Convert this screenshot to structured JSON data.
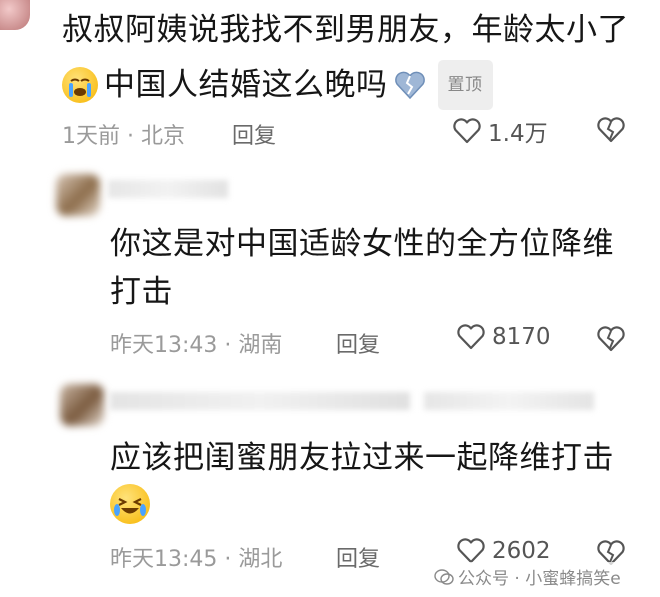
{
  "top_comment": {
    "line1": "叔叔阿姨说我找不到男朋友，年龄太小了",
    "line2_text": "中国人结婚这么晚吗",
    "pin_label": "置顶",
    "time_location": "1天前 · 北京",
    "reply_label": "回复",
    "like_count": "1.4万"
  },
  "replies": [
    {
      "text_line1": "你这是对中国适龄女性的全方位降维",
      "text_line2": "打击",
      "time_location": "昨天13:43 · 湖南",
      "reply_label": "回复",
      "like_count": "8170"
    },
    {
      "text_line1": "应该把闺蜜朋友拉过来一起降维打击",
      "time_location": "昨天13:45 · 湖北",
      "reply_label": "回复",
      "like_count": "2602"
    }
  ],
  "watermark": {
    "text": "公众号 · 小蜜蜂搞笑e"
  },
  "colors": {
    "text": "#161616",
    "meta": "#9a9a9a",
    "icon": "#555555",
    "pin_bg": "#eeeeee"
  }
}
